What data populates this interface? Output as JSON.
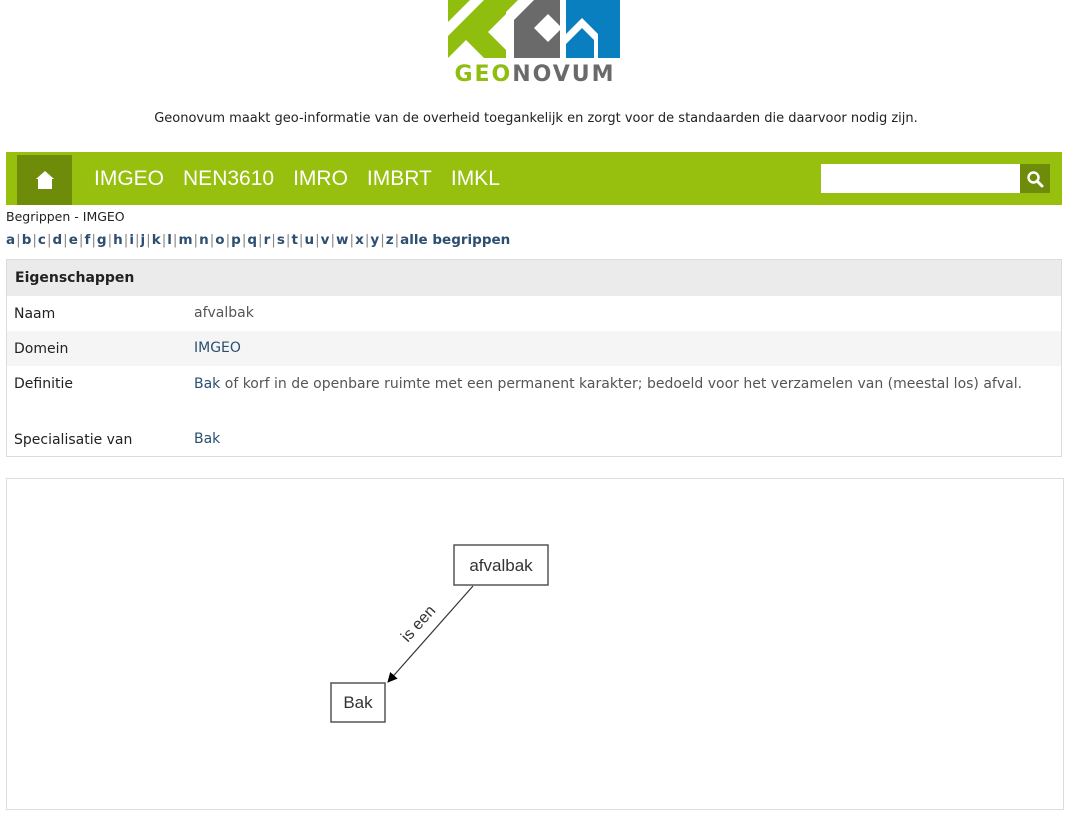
{
  "logo": {
    "part1": "GEO",
    "part2": "NOVUM"
  },
  "tagline": "Geonovum maakt geo-informatie van de overheid toegankelijk en zorgt voor de standaarden die daarvoor nodig zijn.",
  "nav": {
    "items": [
      {
        "label": "IMGEO"
      },
      {
        "label": "NEN3610"
      },
      {
        "label": "IMRO"
      },
      {
        "label": "IMBRT"
      },
      {
        "label": "IMKL"
      }
    ],
    "search": {
      "value": "",
      "placeholder": ""
    }
  },
  "breadcrumb": "Begrippen - IMGEO",
  "alphabet": {
    "letters": [
      "a",
      "b",
      "c",
      "d",
      "e",
      "f",
      "g",
      "h",
      "i",
      "j",
      "k",
      "l",
      "m",
      "n",
      "o",
      "p",
      "q",
      "r",
      "s",
      "t",
      "u",
      "v",
      "w",
      "x",
      "y",
      "z"
    ],
    "all_label": "alle begrippen"
  },
  "properties": {
    "header": "Eigenschappen",
    "naam_label": "Naam",
    "naam_value": "afvalbak",
    "domein_label": "Domein",
    "domein_value": "IMGEO",
    "definitie_label": "Definitie",
    "definitie_link": "Bak",
    "definitie_rest": " of korf in de openbare ruimte met een permanent karakter; bedoeld voor het verzamelen van (meestal los) afval.",
    "specialisatie_label": "Specialisatie van",
    "specialisatie_value": "Bak"
  },
  "diagram": {
    "source_node": "afvalbak",
    "target_node": "Bak",
    "edge_label": "is een"
  },
  "colors": {
    "nav_green": "#97bf0d",
    "nav_dark_green": "#6e8c0a",
    "link_blue": "#2c4e70",
    "logo_green": "#8fbe0f",
    "logo_gray": "#6a6a6a",
    "logo_blue": "#0a7fc0"
  }
}
